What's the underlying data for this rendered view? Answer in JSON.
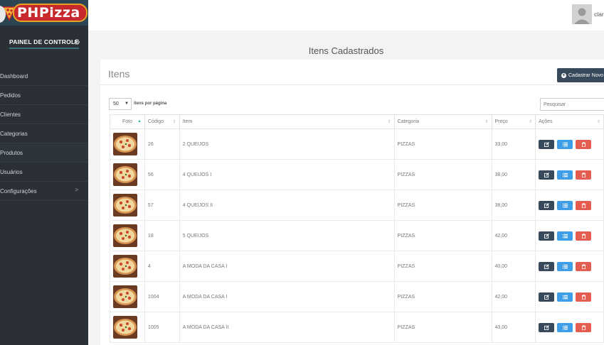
{
  "brand": {
    "name": "PHPizza"
  },
  "sidebar": {
    "panel_title": "PAINEL DE CONTROLE",
    "items": [
      {
        "label": "Dashboard"
      },
      {
        "label": "Pedidos"
      },
      {
        "label": "Clientes"
      },
      {
        "label": "Categorias"
      },
      {
        "label": "Produtos"
      },
      {
        "label": "Usuários"
      },
      {
        "label": "Configurações",
        "arrow": ">"
      }
    ]
  },
  "topbar": {
    "user_name": "clar"
  },
  "page": {
    "title": "Itens Cadastrados"
  },
  "panel": {
    "heading": "Itens",
    "new_button": "Cadastrar Novo",
    "page_size": "50",
    "page_size_label": "itens por página",
    "search_placeholder": "Pesquisar"
  },
  "table": {
    "columns": [
      "Foto",
      "Código",
      "Item",
      "Categoria",
      "Preço",
      "Ações"
    ],
    "rows": [
      {
        "code": "26",
        "item": "2 QUEIJOS",
        "category": "PIZZAS",
        "price": "33,00"
      },
      {
        "code": "56",
        "item": "4 QUEIJOS I",
        "category": "PIZZAS",
        "price": "38,00"
      },
      {
        "code": "57",
        "item": "4 QUEIJOS II",
        "category": "PIZZAS",
        "price": "38,00"
      },
      {
        "code": "18",
        "item": "5 QUEIJOS",
        "category": "PIZZAS",
        "price": "42,00"
      },
      {
        "code": "4",
        "item": "A MODA DA CASA I",
        "category": "PIZZAS",
        "price": "40,00"
      },
      {
        "code": "1004",
        "item": "A MODA DA CASA I",
        "category": "PIZZAS",
        "price": "42,00"
      },
      {
        "code": "1005",
        "item": "A MODA DA CASA II",
        "category": "PIZZAS",
        "price": "43,00"
      }
    ]
  },
  "colors": {
    "sidebar": "#2a3036",
    "edit": "#37495a",
    "list": "#3f9ee8",
    "delete": "#e45d50"
  }
}
